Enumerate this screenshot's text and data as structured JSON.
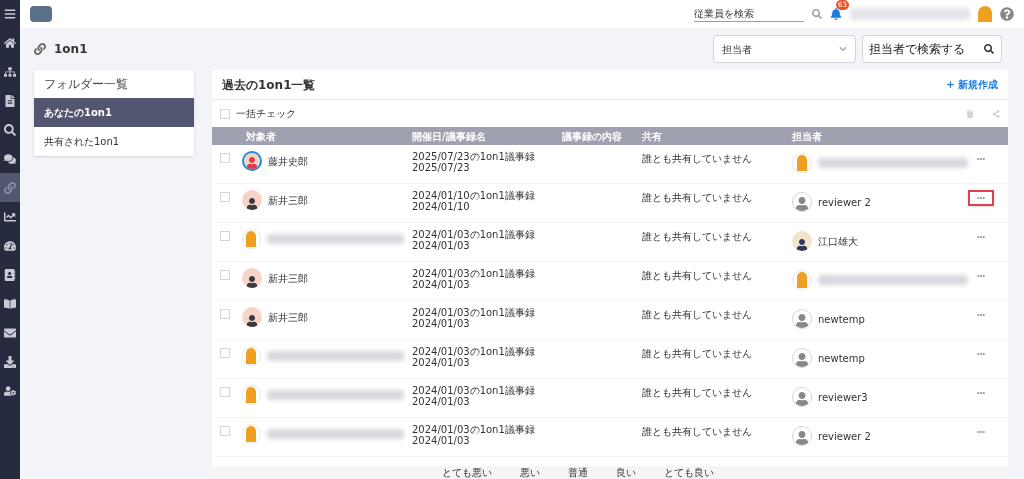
{
  "topbar": {
    "search": {
      "placeholder": "従業員を検索"
    },
    "notification_count": "63"
  },
  "sidebar": {
    "items": [
      {
        "selected": false
      },
      {
        "selected": false
      },
      {
        "selected": false
      },
      {
        "selected": false
      },
      {
        "selected": false
      },
      {
        "selected": true
      },
      {
        "selected": false
      },
      {
        "selected": false
      },
      {
        "selected": false
      },
      {
        "selected": false
      },
      {
        "selected": false
      },
      {
        "selected": false
      },
      {
        "selected": false
      }
    ]
  },
  "page": {
    "title": "1on1",
    "filter": {
      "value": "担当者"
    },
    "search": {
      "placeholder": "担当者で検索する"
    }
  },
  "folders": {
    "title": "フォルダー一覧",
    "items": [
      {
        "label": "あなたの1on1",
        "selected": true
      },
      {
        "label": "共有された1on1",
        "selected": false
      }
    ]
  },
  "list": {
    "title": "過去の1on1一覧",
    "new_button": "+ 新規作成",
    "bulk_check": {
      "label": "一括チェック",
      "checked": false
    },
    "columns": [
      "対象者",
      "開催日/議事録名",
      "議事録の内容",
      "共有",
      "担当者"
    ],
    "rows": [
      {
        "checked": false,
        "subject": {
          "name": "藤井史郎",
          "kind": "ring"
        },
        "title": "2025/07/23の1on1議事録",
        "date": "2025/07/23",
        "shared": "誰とも共有していません",
        "owner": {
          "kind": "mascot"
        },
        "highlighted": false
      },
      {
        "checked": false,
        "subject": {
          "name": "新井三郎",
          "kind": "pink"
        },
        "title": "2024/01/10の1on1議事録",
        "date": "2024/01/10",
        "shared": "誰とも共有していません",
        "owner": {
          "name": "reviewer 2",
          "kind": "generic"
        },
        "highlighted": true
      },
      {
        "checked": false,
        "subject": {
          "kind": "mascot"
        },
        "title": "2024/01/03の1on1議事録",
        "date": "2024/01/03",
        "shared": "誰とも共有していません",
        "owner": {
          "name": "江口雄大",
          "kind": "man"
        },
        "highlighted": false
      },
      {
        "checked": false,
        "subject": {
          "name": "新井三郎",
          "kind": "pink"
        },
        "title": "2024/01/03の1on1議事録",
        "date": "2024/01/03",
        "shared": "誰とも共有していません",
        "owner": {
          "kind": "mascot"
        },
        "highlighted": false
      },
      {
        "checked": false,
        "subject": {
          "name": "新井三郎",
          "kind": "pink"
        },
        "title": "2024/01/03の1on1議事録",
        "date": "2024/01/03",
        "shared": "誰とも共有していません",
        "owner": {
          "name": "newtemp",
          "kind": "generic"
        },
        "highlighted": false
      },
      {
        "checked": false,
        "subject": {
          "kind": "mascot"
        },
        "title": "2024/01/03の1on1議事録",
        "date": "2024/01/03",
        "shared": "誰とも共有していません",
        "owner": {
          "name": "newtemp",
          "kind": "generic"
        },
        "highlighted": false
      },
      {
        "checked": false,
        "subject": {
          "kind": "mascot"
        },
        "title": "2024/01/03の1on1議事録",
        "date": "2024/01/03",
        "shared": "誰とも共有していません",
        "owner": {
          "name": "reviewer3",
          "kind": "generic"
        },
        "highlighted": false
      },
      {
        "checked": false,
        "subject": {
          "kind": "mascot"
        },
        "title": "2024/01/03の1on1議事録",
        "date": "2024/01/03",
        "shared": "誰とも共有していません",
        "owner": {
          "name": "reviewer 2",
          "kind": "generic"
        },
        "highlighted": false
      }
    ]
  },
  "footer_labels": [
    "とても悪い",
    "悪い",
    "普通",
    "良い",
    "とても良い"
  ]
}
